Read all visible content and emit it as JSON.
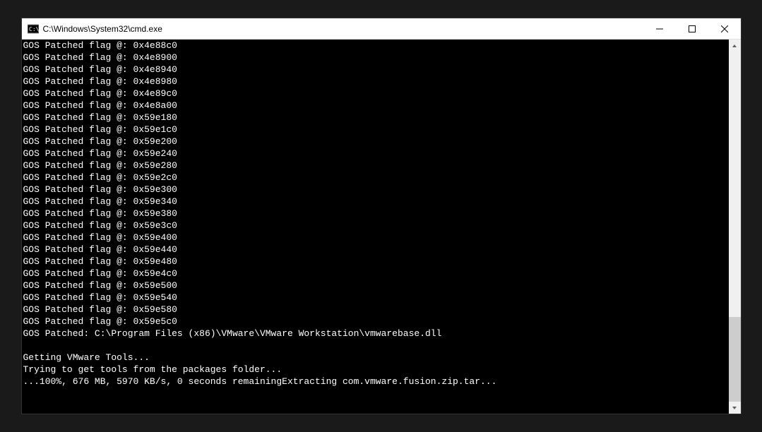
{
  "window": {
    "title": "C:\\Windows\\System32\\cmd.exe"
  },
  "terminal": {
    "lines": [
      "GOS Patched flag @: 0x4e88c0",
      "GOS Patched flag @: 0x4e8900",
      "GOS Patched flag @: 0x4e8940",
      "GOS Patched flag @: 0x4e8980",
      "GOS Patched flag @: 0x4e89c0",
      "GOS Patched flag @: 0x4e8a00",
      "GOS Patched flag @: 0x59e180",
      "GOS Patched flag @: 0x59e1c0",
      "GOS Patched flag @: 0x59e200",
      "GOS Patched flag @: 0x59e240",
      "GOS Patched flag @: 0x59e280",
      "GOS Patched flag @: 0x59e2c0",
      "GOS Patched flag @: 0x59e300",
      "GOS Patched flag @: 0x59e340",
      "GOS Patched flag @: 0x59e380",
      "GOS Patched flag @: 0x59e3c0",
      "GOS Patched flag @: 0x59e400",
      "GOS Patched flag @: 0x59e440",
      "GOS Patched flag @: 0x59e480",
      "GOS Patched flag @: 0x59e4c0",
      "GOS Patched flag @: 0x59e500",
      "GOS Patched flag @: 0x59e540",
      "GOS Patched flag @: 0x59e580",
      "GOS Patched flag @: 0x59e5c0",
      "GOS Patched: C:\\Program Files (x86)\\VMware\\VMware Workstation\\vmwarebase.dll",
      "",
      "Getting VMware Tools...",
      "Trying to get tools from the packages folder...",
      "...100%, 676 MB, 5970 KB/s, 0 seconds remainingExtracting com.vmware.fusion.zip.tar..."
    ]
  }
}
